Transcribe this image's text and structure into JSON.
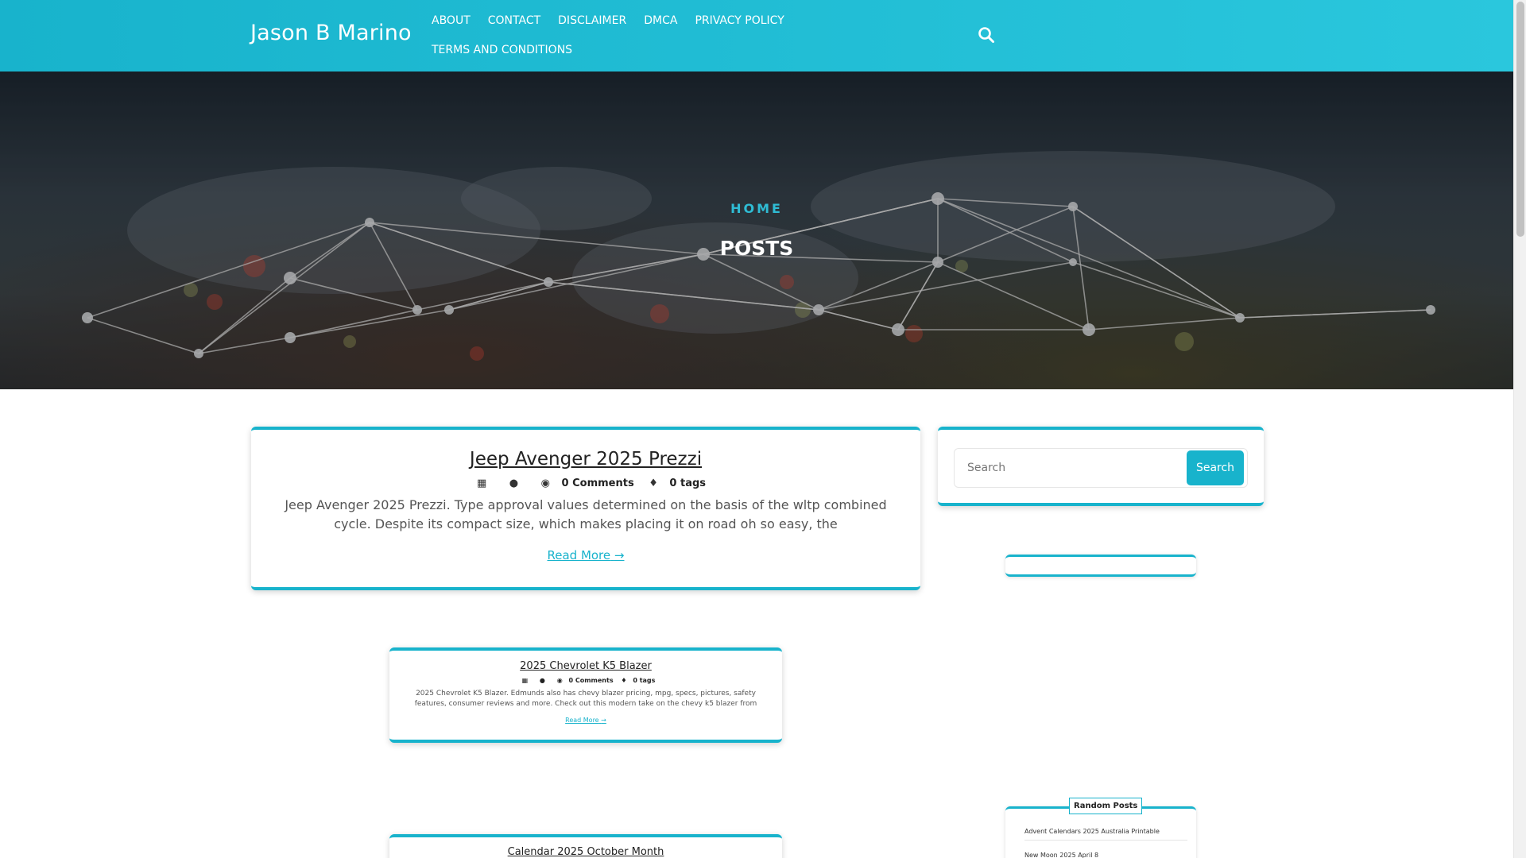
{
  "site": {
    "title": "Jason B Marino"
  },
  "nav": {
    "items": [
      {
        "label": "ABOUT"
      },
      {
        "label": "CONTACT"
      },
      {
        "label": "DISCLAIMER"
      },
      {
        "label": "DMCA"
      },
      {
        "label": "PRIVACY POLICY"
      },
      {
        "label": "TERMS AND CONDITIONS"
      }
    ],
    "search_icon": "search-icon"
  },
  "banner": {
    "breadcrumb": "HOME",
    "title": "POSTS"
  },
  "posts": [
    {
      "title": "Jeep Avenger 2025 Prezzi",
      "comments": "0 Comments",
      "tags": "0 tags",
      "excerpt": "Jeep Avenger 2025 Prezzi. Type approval values determined on the basis of the wltp combined cycle. Despite its compact size, which makes placing it on road oh so easy, the",
      "read_more": "Read More"
    },
    {
      "title": "2025 Chevrolet K5 Blazer",
      "comments": "0 Comments",
      "tags": "0 tags",
      "excerpt": "2025 Chevrolet K5 Blazer. Edmunds also has chevy blazer pricing, mpg, specs, pictures, safety features, consumer reviews and more. Check out this modern take on the chevy k5 blazer from",
      "read_more": "Read More"
    },
    {
      "title": "Calendar 2025 October Month"
    }
  ],
  "sidebar": {
    "search": {
      "placeholder": "Search",
      "button": "Search"
    },
    "random_posts": {
      "title": "Random Posts",
      "items": [
        {
          "label": "Advent Calendars 2025 Australia Printable"
        },
        {
          "label": "New Moon 2025 April 8"
        }
      ]
    }
  },
  "colors": {
    "accent": "#18b3cc",
    "header": "#1fbcd3"
  }
}
